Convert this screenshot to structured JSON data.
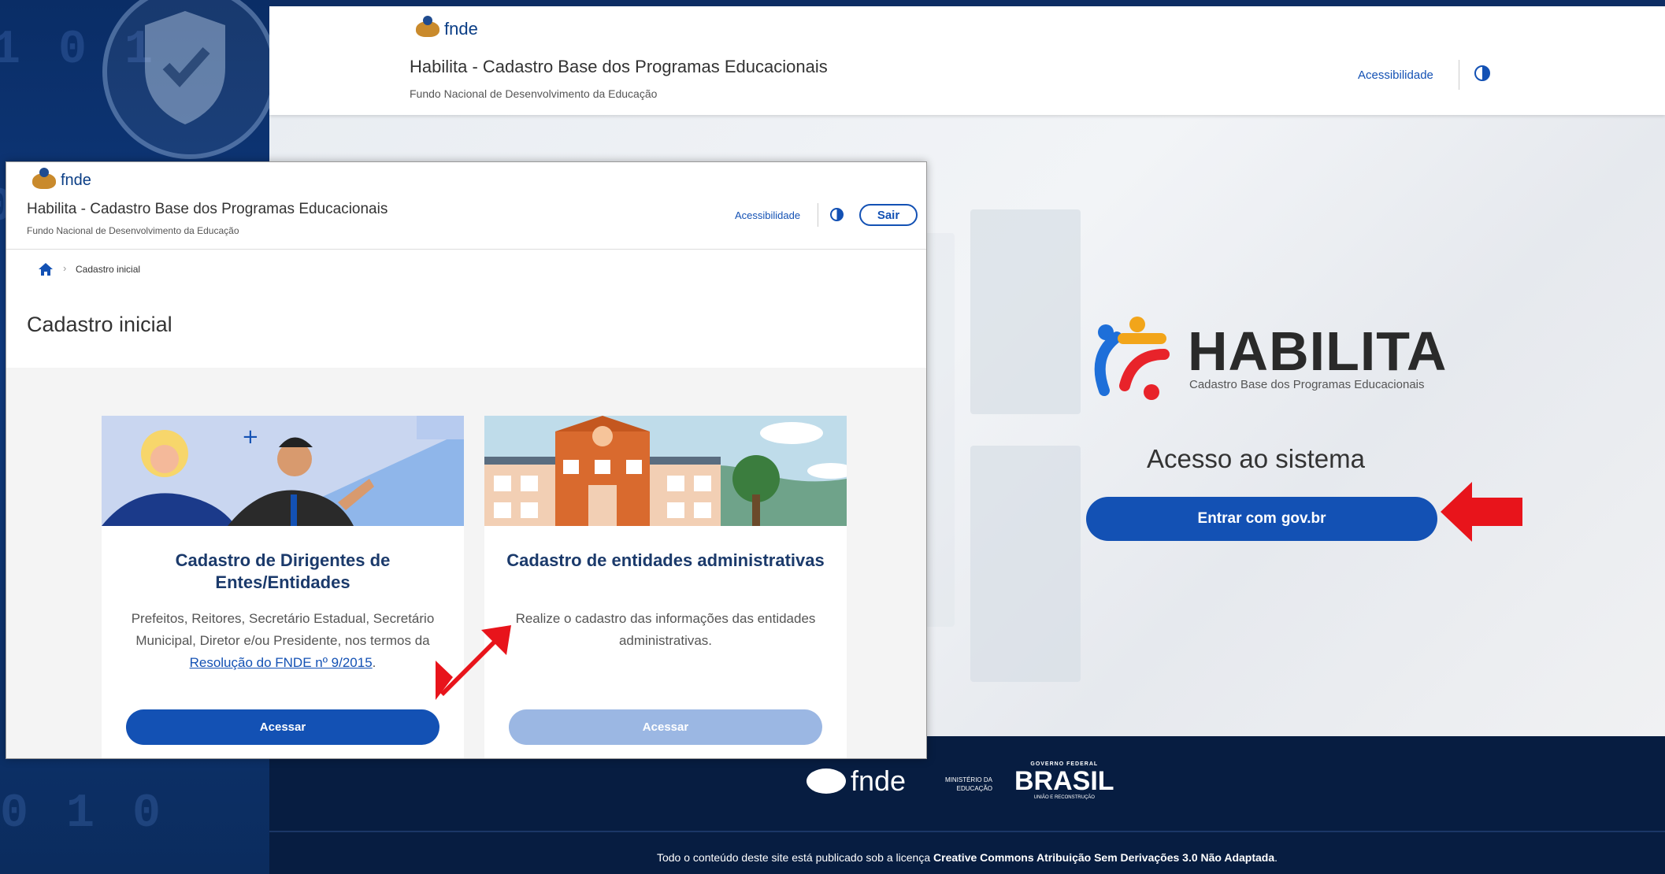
{
  "brand": {
    "fnde_label": "fnde"
  },
  "login": {
    "title": "Habilita - Cadastro Base dos Programas Educacionais",
    "subtitle": "Fundo Nacional de Desenvolvimento da Educação",
    "accessibility": "Acessibilidade",
    "logo_word": "HABILITA",
    "logo_sub": "Cadastro Base dos Programas Educacionais",
    "heading": "Acesso ao sistema",
    "button_prefix": "Entrar com",
    "button_brand": "gov.br"
  },
  "footer": {
    "fnde_label": "fnde",
    "ministerio": "MINISTÉRIO DA EDUCAÇÃO",
    "gov_top": "GOVERNO FEDERAL",
    "gov_word": "BRASIL",
    "gov_bottom": "UNIÃO E RECONSTRUÇÃO",
    "license_prefix": "Todo o conteúdo deste site está publicado sob a licença",
    "license_name": "Creative Commons Atribuição Sem Derivações 3.0 Não Adaptada",
    "license_suffix": "."
  },
  "window": {
    "title": "Habilita - Cadastro Base dos Programas Educacionais",
    "subtitle": "Fundo Nacional de Desenvolvimento da Educação",
    "accessibility": "Acessibilidade",
    "logout": "Sair",
    "breadcrumb_current": "Cadastro inicial",
    "page_title": "Cadastro inicial"
  },
  "cards": [
    {
      "title": "Cadastro de Dirigentes de Entes/Entidades",
      "desc_text": "Prefeitos, Reitores, Secretário Estadual, Secretário Municipal, Diretor e/ou Presidente, nos termos da",
      "desc_link": "Resolução do FNDE nº 9/2015",
      "desc_end": ".",
      "button": "Acessar",
      "enabled": true
    },
    {
      "title": "Cadastro de entidades administrativas",
      "desc_text": "Realize o cadastro das informações das entidades administrativas.",
      "desc_link": "",
      "desc_end": "",
      "button": "Acessar",
      "enabled": false
    }
  ],
  "colors": {
    "primary": "#1351b4",
    "disabled": "#9bb7e3",
    "footer": "#071d41",
    "arrow": "#e8141b"
  }
}
